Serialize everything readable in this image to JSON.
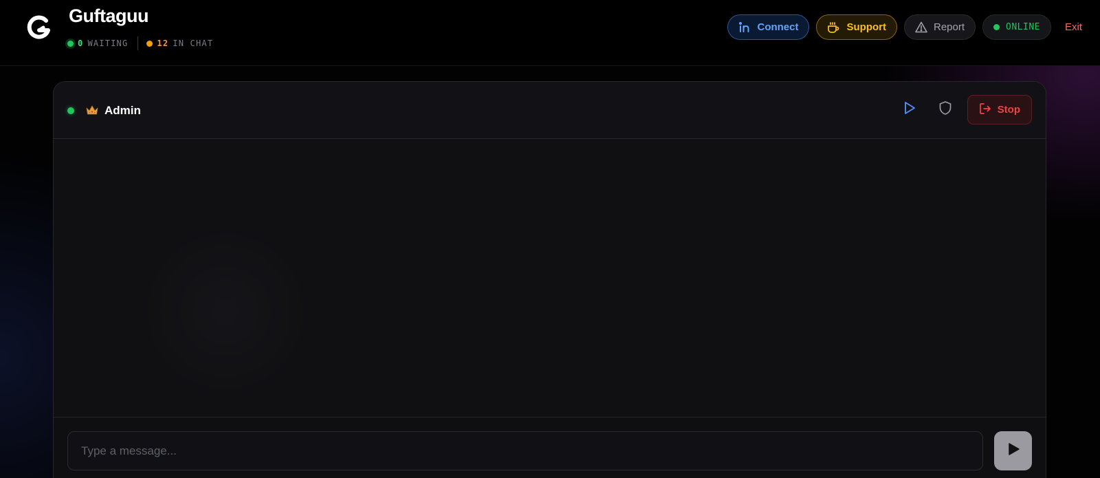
{
  "app": {
    "brand": "Guftaguu"
  },
  "stats": {
    "waiting_count": "0",
    "waiting_label": "WAITING",
    "in_chat_count": "12",
    "in_chat_label": "IN CHAT"
  },
  "header_actions": {
    "connect_label": "Connect",
    "support_label": "Support",
    "report_label": "Report",
    "online_label": "ONLINE",
    "exit_label": "Exit"
  },
  "chat": {
    "peer_name": "Admin",
    "stop_label": "Stop",
    "input_placeholder": "Type a message...",
    "input_value": ""
  },
  "icons": {
    "logo": "g-logo-icon",
    "connect": "linkedin-icon",
    "support": "coffee-cup-icon",
    "report": "warning-triangle-icon",
    "peer_badge": "crown-icon",
    "next": "play-icon",
    "safety": "shield-icon",
    "stop": "logout-icon",
    "send": "send-icon"
  },
  "colors": {
    "online_green": "#22c55e",
    "in_chat_orange": "#f59e0b",
    "connect_blue": "#60a5fa",
    "support_gold": "#fbbf24",
    "stop_red": "#ef4444",
    "exit_red": "#ef6b6b"
  }
}
